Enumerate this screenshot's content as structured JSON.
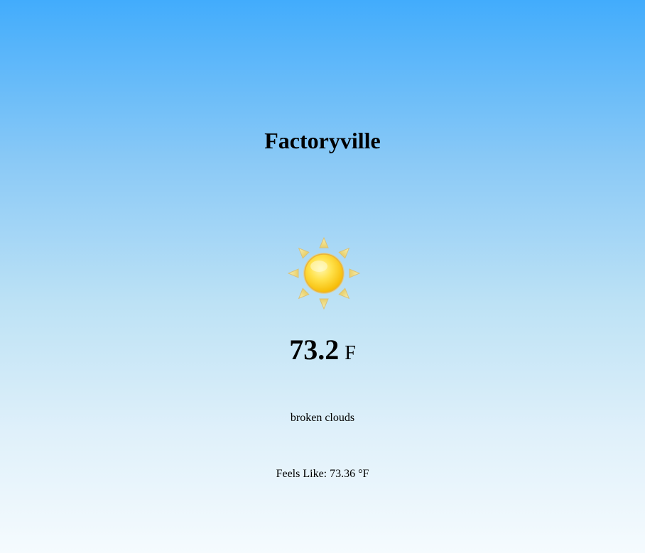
{
  "weather": {
    "city": "Factoryville",
    "icon": "sun-icon",
    "temperature": "73.2",
    "unit": "F",
    "description": "broken clouds",
    "feels_like_label": "Feels Like:",
    "feels_like_value": "73.36",
    "feels_like_unit": "°F"
  },
  "colors": {
    "sky_top": "#42acfc",
    "sky_bottom": "#f5fbfe",
    "sun": "#ffd21f"
  }
}
